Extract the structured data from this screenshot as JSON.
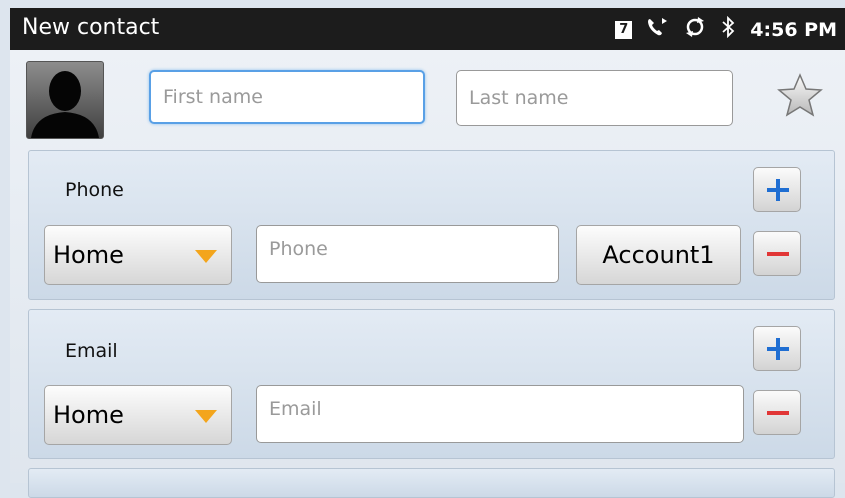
{
  "status_bar": {
    "title": "New contact",
    "calendar_day": "7",
    "time": "4:56 PM"
  },
  "name": {
    "first_placeholder": "First name",
    "last_placeholder": "Last name"
  },
  "phone": {
    "label": "Phone",
    "type": "Home",
    "placeholder": "Phone",
    "account": "Account1"
  },
  "email": {
    "label": "Email",
    "type": "Home",
    "placeholder": "Email"
  },
  "colors": {
    "status_bar": "#1c1c1c",
    "accent_plus": "#1f6ed2",
    "accent_minus": "#e13636",
    "focus": "#59a0e6",
    "dropdown_arrow": "#f3a51c"
  }
}
